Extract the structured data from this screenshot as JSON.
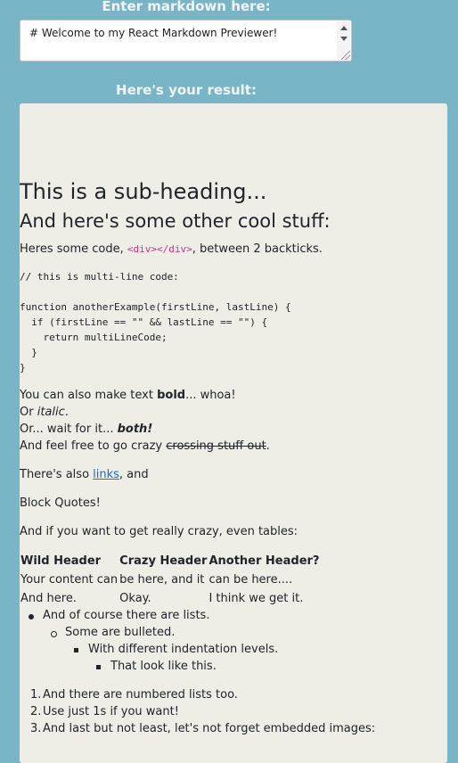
{
  "editor": {
    "label": "Enter markdown here:",
    "value": "# Welcome to my React Markdown Previewer!"
  },
  "result": {
    "label": "Here's your result:"
  },
  "preview": {
    "h2": "This is a sub-heading...",
    "h3": "And here's some other cool stuff:",
    "code_line": {
      "before": "Heres some code, ",
      "code": "<div></div>",
      "after": ", between 2 backticks."
    },
    "code_block": "// this is multi-line code:\n\nfunction anotherExample(firstLine, lastLine) {\n  if (firstLine == \"\" && lastLine == \"\") {\n    return multiLineCode;\n  }\n}",
    "bold_line": {
      "before": "You can also make text ",
      "bold": "bold",
      "after": "... whoa!"
    },
    "italic_line": {
      "before": "Or ",
      "italic": "italic",
      "after": "."
    },
    "both_line": {
      "before": "Or... wait for it... ",
      "both": "both!"
    },
    "strike_line": {
      "before": "And feel free to go crazy ",
      "strike": "crossing stuff out",
      "after": "."
    },
    "links_line": {
      "before": "There's also ",
      "link": "links",
      "after": ", and"
    },
    "blockquote": "Block Quotes!",
    "tables_intro": "And if you want to get really crazy, even tables:",
    "table": {
      "headers": [
        "Wild Header",
        "Crazy Header",
        "Another Header?"
      ],
      "rows": [
        [
          "Your content can",
          "be here, and it",
          "can be here...."
        ],
        [
          "And here.",
          "Okay.",
          "I think we get it."
        ]
      ]
    },
    "list": [
      "And of course there are lists.",
      "Some are bulleted.",
      "With different indentation levels.",
      "That look like this."
    ],
    "numbered_list": [
      "And there are numbered lists too.",
      "Use just 1s if you want!",
      "And last but not least, let's not forget embedded images:"
    ]
  }
}
